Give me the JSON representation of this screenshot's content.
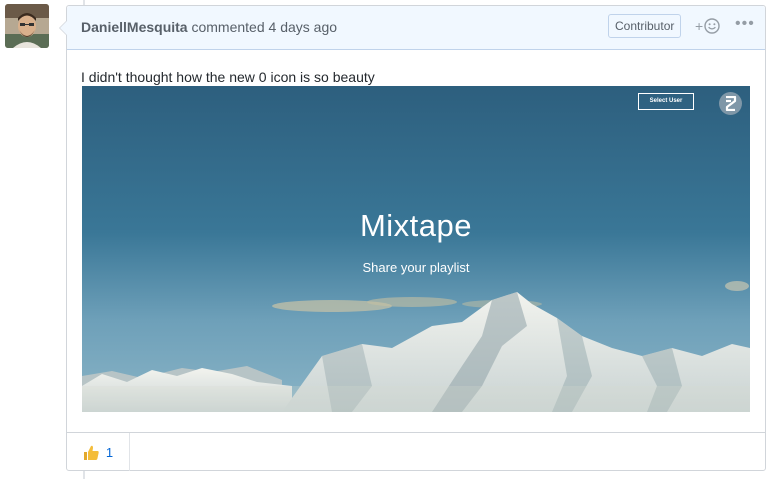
{
  "comment": {
    "author": "DaniellMesquita",
    "action": "commented",
    "time": "4 days ago",
    "badge": "Contributor",
    "add_reaction_label": "+",
    "more_label": "•••",
    "text": "I didn't thought how the new 0 icon is so beauty"
  },
  "screenshot": {
    "select_user_label": "Select User",
    "title": "Mixtape",
    "subtitle": "Share your playlist"
  },
  "reactions": [
    {
      "icon": "thumbs-up-icon",
      "count": "1"
    }
  ]
}
